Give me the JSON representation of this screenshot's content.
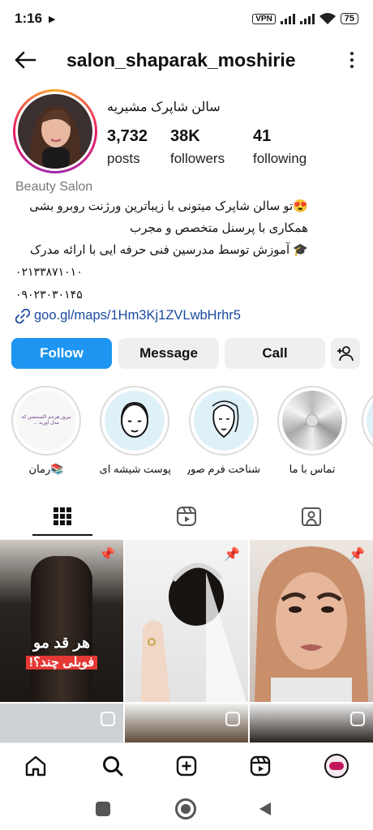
{
  "status_bar": {
    "time": "1:16",
    "vpn": "VPN",
    "battery": "75"
  },
  "header": {
    "username": "salon_shaparak_moshirie"
  },
  "profile": {
    "full_name": "سالن شاپرک مشیریه",
    "stats": [
      {
        "value": "3,732",
        "label": "posts"
      },
      {
        "value": "38K",
        "label": "followers"
      },
      {
        "value": "41",
        "label": "following"
      }
    ],
    "category": "Beauty Salon",
    "bio_lines": [
      "😍تو سالن شاپرک میتونی با زیباترین ورژنت روبرو بشی",
      "همکاری با پرسنل متخصص و مجرب",
      "🎓 آموزش توسط مدرسین فنی حرفه ایی با ارائه مدرک",
      "۰۲۱۳۳۸۷۱۰۱۰",
      "۰۹۰۲۳۰۳۰۱۴۵"
    ],
    "link": "goo.gl/maps/1Hm3Kj1ZVLwbHrhr5"
  },
  "actions": {
    "follow": "Follow",
    "message": "Message",
    "call": "Call"
  },
  "highlights": [
    {
      "label": "📚رمان",
      "cover_text": "بیروز هرجم اکستنشن که مدل اوربد ..."
    },
    {
      "label": "پوست شیشه ای ..."
    },
    {
      "label": "شناخت فرم صور..."
    },
    {
      "label": "تماس با ما"
    }
  ],
  "grid": {
    "cells": [
      {
        "caption_line1": "هر قد مو",
        "caption_line2": "فوبلی چند؟!"
      },
      {},
      {},
      {},
      {},
      {}
    ]
  },
  "colors": {
    "accent": "#1e95f0",
    "link": "#1b4ba0"
  }
}
